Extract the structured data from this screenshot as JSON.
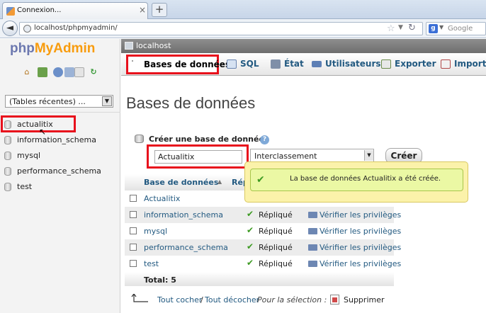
{
  "browser": {
    "tab_title": "Connexion...",
    "tab_close": "×",
    "new_tab": "+",
    "back": "◄",
    "url": "localhost/phpmyadmin/",
    "search_engine": "g",
    "search_placeholder": "Google"
  },
  "sidebar": {
    "logo_php": "php",
    "logo_my": "MyAdmin",
    "recent_tables": "(Tables récentes) ...",
    "databases": [
      "actualitix",
      "information_schema",
      "mysql",
      "performance_schema",
      "test"
    ]
  },
  "server": {
    "label": "localhost"
  },
  "top_menu": {
    "databases": "Bases de données",
    "sql": "SQL",
    "status": "État",
    "users": "Utilisateurs",
    "export": "Exporter",
    "import": "Importer"
  },
  "main": {
    "title": "Bases de données",
    "create_label": "Créer une base de données",
    "help": "?",
    "new_db_name": "Actualitix",
    "collation": "Interclassement",
    "create_button": "Créer"
  },
  "table": {
    "col_name": "Base de données",
    "col_replication": "Répl",
    "rows": [
      {
        "name": "Actualitix",
        "replicated": "",
        "privileges": ""
      },
      {
        "name": "information_schema",
        "replicated": "Répliqué",
        "privileges": "Vérifier les privilèges"
      },
      {
        "name": "mysql",
        "replicated": "Répliqué",
        "privileges": "Vérifier les privilèges"
      },
      {
        "name": "performance_schema",
        "replicated": "Répliqué",
        "privileges": "Vérifier les privilèges"
      },
      {
        "name": "test",
        "replicated": "Répliqué",
        "privileges": "Vérifier les privilèges"
      }
    ],
    "total": "Total: 5"
  },
  "notification": {
    "message": "La base de données Actualitix a été créée."
  },
  "bottom": {
    "check_all": "Tout cocher",
    "separator": "/",
    "uncheck_all": "Tout décocher",
    "for_selection": "Pour la sélection :",
    "delete": "Supprimer"
  },
  "colors": {
    "highlight_red": "#e8101c",
    "link_blue": "#235a81",
    "success_green": "#3c9a22"
  }
}
